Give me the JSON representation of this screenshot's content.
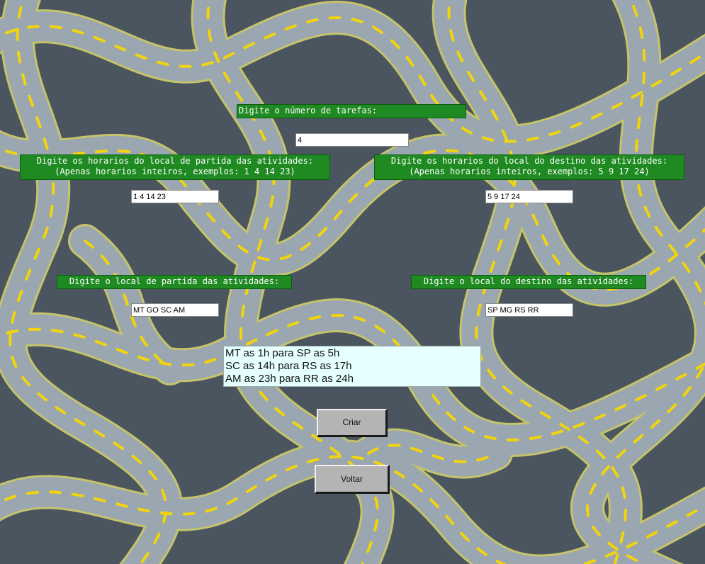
{
  "labels": {
    "num_tasks": "Digite o número de tarefas:",
    "start_times": "Digite os horarios do local de partida das atividades:\n(Apenas horarios inteiros, exemplos: 1 4 14 23)",
    "end_times": "Digite os horarios do local do destino das atividades:\n(Apenas horarios inteiros, exemplos: 5 9 17 24)",
    "start_places": "Digite o local de partida das atividades:",
    "end_places": "Digite o local do destino das atividades:"
  },
  "inputs": {
    "num_tasks": "4",
    "start_times": "1 4 14 23",
    "end_times": "5 9 17 24",
    "start_places": "MT GO SC AM",
    "end_places": "SP MG RS RR"
  },
  "output_lines": [
    "MT as 1h para SP as 5h",
    "SC as 14h para RS as 17h",
    "AM as 23h para RR as 24h"
  ],
  "buttons": {
    "create": "Criar",
    "back": "Voltar"
  },
  "colors": {
    "label_bg": "#1f8a22",
    "road": "#9aa6b0",
    "road_edge": "#c8c864",
    "road_dash": "#f2d40c",
    "ground": "#4a5560"
  }
}
